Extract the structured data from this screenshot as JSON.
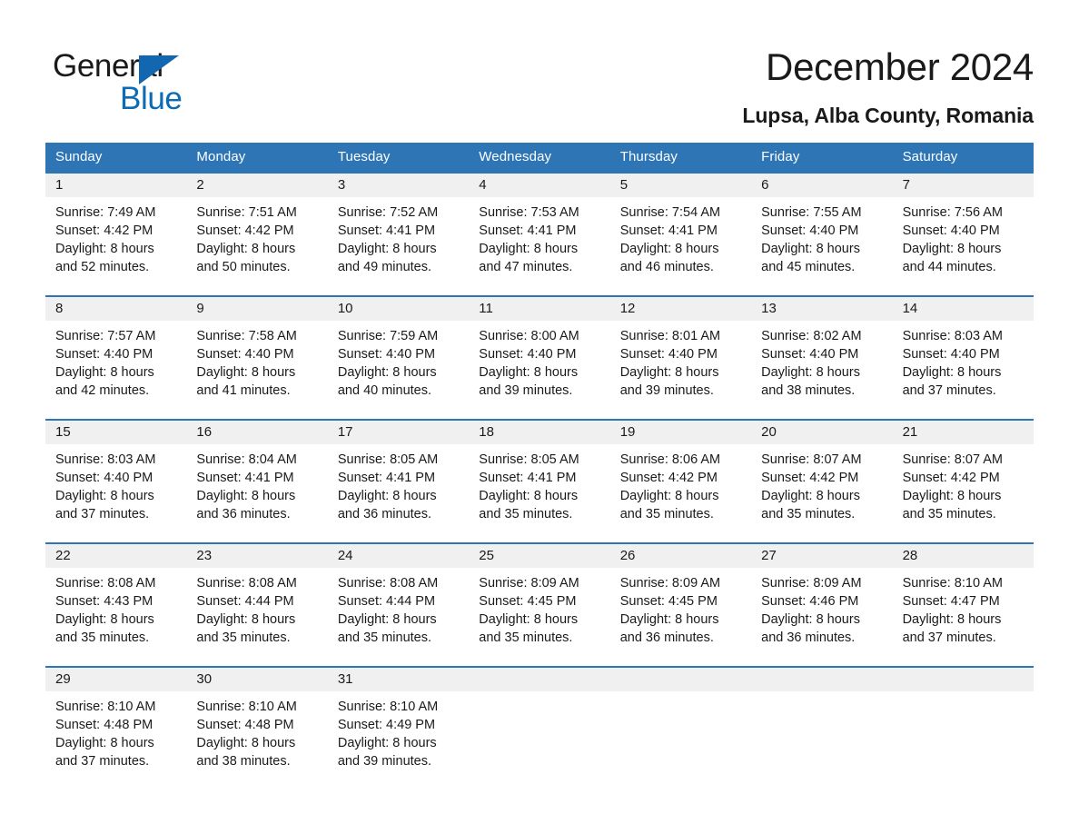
{
  "logo": {
    "word_one": "General",
    "word_two": "Blue",
    "triangle_color": "#1267b0",
    "blue_text_color": "#0b6cb5"
  },
  "header": {
    "title": "December 2024",
    "subtitle": "Lupsa, Alba County, Romania"
  },
  "theme": {
    "header_bar": "#2e75b6",
    "daynum_row": "#f0f0f0",
    "text": "#1a1a1a"
  },
  "weekdays": [
    "Sunday",
    "Monday",
    "Tuesday",
    "Wednesday",
    "Thursday",
    "Friday",
    "Saturday"
  ],
  "weeks": [
    [
      {
        "day": "1",
        "sunrise": "Sunrise: 7:49 AM",
        "sunset": "Sunset: 4:42 PM",
        "daylight_1": "Daylight: 8 hours",
        "daylight_2": "and 52 minutes."
      },
      {
        "day": "2",
        "sunrise": "Sunrise: 7:51 AM",
        "sunset": "Sunset: 4:42 PM",
        "daylight_1": "Daylight: 8 hours",
        "daylight_2": "and 50 minutes."
      },
      {
        "day": "3",
        "sunrise": "Sunrise: 7:52 AM",
        "sunset": "Sunset: 4:41 PM",
        "daylight_1": "Daylight: 8 hours",
        "daylight_2": "and 49 minutes."
      },
      {
        "day": "4",
        "sunrise": "Sunrise: 7:53 AM",
        "sunset": "Sunset: 4:41 PM",
        "daylight_1": "Daylight: 8 hours",
        "daylight_2": "and 47 minutes."
      },
      {
        "day": "5",
        "sunrise": "Sunrise: 7:54 AM",
        "sunset": "Sunset: 4:41 PM",
        "daylight_1": "Daylight: 8 hours",
        "daylight_2": "and 46 minutes."
      },
      {
        "day": "6",
        "sunrise": "Sunrise: 7:55 AM",
        "sunset": "Sunset: 4:40 PM",
        "daylight_1": "Daylight: 8 hours",
        "daylight_2": "and 45 minutes."
      },
      {
        "day": "7",
        "sunrise": "Sunrise: 7:56 AM",
        "sunset": "Sunset: 4:40 PM",
        "daylight_1": "Daylight: 8 hours",
        "daylight_2": "and 44 minutes."
      }
    ],
    [
      {
        "day": "8",
        "sunrise": "Sunrise: 7:57 AM",
        "sunset": "Sunset: 4:40 PM",
        "daylight_1": "Daylight: 8 hours",
        "daylight_2": "and 42 minutes."
      },
      {
        "day": "9",
        "sunrise": "Sunrise: 7:58 AM",
        "sunset": "Sunset: 4:40 PM",
        "daylight_1": "Daylight: 8 hours",
        "daylight_2": "and 41 minutes."
      },
      {
        "day": "10",
        "sunrise": "Sunrise: 7:59 AM",
        "sunset": "Sunset: 4:40 PM",
        "daylight_1": "Daylight: 8 hours",
        "daylight_2": "and 40 minutes."
      },
      {
        "day": "11",
        "sunrise": "Sunrise: 8:00 AM",
        "sunset": "Sunset: 4:40 PM",
        "daylight_1": "Daylight: 8 hours",
        "daylight_2": "and 39 minutes."
      },
      {
        "day": "12",
        "sunrise": "Sunrise: 8:01 AM",
        "sunset": "Sunset: 4:40 PM",
        "daylight_1": "Daylight: 8 hours",
        "daylight_2": "and 39 minutes."
      },
      {
        "day": "13",
        "sunrise": "Sunrise: 8:02 AM",
        "sunset": "Sunset: 4:40 PM",
        "daylight_1": "Daylight: 8 hours",
        "daylight_2": "and 38 minutes."
      },
      {
        "day": "14",
        "sunrise": "Sunrise: 8:03 AM",
        "sunset": "Sunset: 4:40 PM",
        "daylight_1": "Daylight: 8 hours",
        "daylight_2": "and 37 minutes."
      }
    ],
    [
      {
        "day": "15",
        "sunrise": "Sunrise: 8:03 AM",
        "sunset": "Sunset: 4:40 PM",
        "daylight_1": "Daylight: 8 hours",
        "daylight_2": "and 37 minutes."
      },
      {
        "day": "16",
        "sunrise": "Sunrise: 8:04 AM",
        "sunset": "Sunset: 4:41 PM",
        "daylight_1": "Daylight: 8 hours",
        "daylight_2": "and 36 minutes."
      },
      {
        "day": "17",
        "sunrise": "Sunrise: 8:05 AM",
        "sunset": "Sunset: 4:41 PM",
        "daylight_1": "Daylight: 8 hours",
        "daylight_2": "and 36 minutes."
      },
      {
        "day": "18",
        "sunrise": "Sunrise: 8:05 AM",
        "sunset": "Sunset: 4:41 PM",
        "daylight_1": "Daylight: 8 hours",
        "daylight_2": "and 35 minutes."
      },
      {
        "day": "19",
        "sunrise": "Sunrise: 8:06 AM",
        "sunset": "Sunset: 4:42 PM",
        "daylight_1": "Daylight: 8 hours",
        "daylight_2": "and 35 minutes."
      },
      {
        "day": "20",
        "sunrise": "Sunrise: 8:07 AM",
        "sunset": "Sunset: 4:42 PM",
        "daylight_1": "Daylight: 8 hours",
        "daylight_2": "and 35 minutes."
      },
      {
        "day": "21",
        "sunrise": "Sunrise: 8:07 AM",
        "sunset": "Sunset: 4:42 PM",
        "daylight_1": "Daylight: 8 hours",
        "daylight_2": "and 35 minutes."
      }
    ],
    [
      {
        "day": "22",
        "sunrise": "Sunrise: 8:08 AM",
        "sunset": "Sunset: 4:43 PM",
        "daylight_1": "Daylight: 8 hours",
        "daylight_2": "and 35 minutes."
      },
      {
        "day": "23",
        "sunrise": "Sunrise: 8:08 AM",
        "sunset": "Sunset: 4:44 PM",
        "daylight_1": "Daylight: 8 hours",
        "daylight_2": "and 35 minutes."
      },
      {
        "day": "24",
        "sunrise": "Sunrise: 8:08 AM",
        "sunset": "Sunset: 4:44 PM",
        "daylight_1": "Daylight: 8 hours",
        "daylight_2": "and 35 minutes."
      },
      {
        "day": "25",
        "sunrise": "Sunrise: 8:09 AM",
        "sunset": "Sunset: 4:45 PM",
        "daylight_1": "Daylight: 8 hours",
        "daylight_2": "and 35 minutes."
      },
      {
        "day": "26",
        "sunrise": "Sunrise: 8:09 AM",
        "sunset": "Sunset: 4:45 PM",
        "daylight_1": "Daylight: 8 hours",
        "daylight_2": "and 36 minutes."
      },
      {
        "day": "27",
        "sunrise": "Sunrise: 8:09 AM",
        "sunset": "Sunset: 4:46 PM",
        "daylight_1": "Daylight: 8 hours",
        "daylight_2": "and 36 minutes."
      },
      {
        "day": "28",
        "sunrise": "Sunrise: 8:10 AM",
        "sunset": "Sunset: 4:47 PM",
        "daylight_1": "Daylight: 8 hours",
        "daylight_2": "and 37 minutes."
      }
    ],
    [
      {
        "day": "29",
        "sunrise": "Sunrise: 8:10 AM",
        "sunset": "Sunset: 4:48 PM",
        "daylight_1": "Daylight: 8 hours",
        "daylight_2": "and 37 minutes."
      },
      {
        "day": "30",
        "sunrise": "Sunrise: 8:10 AM",
        "sunset": "Sunset: 4:48 PM",
        "daylight_1": "Daylight: 8 hours",
        "daylight_2": "and 38 minutes."
      },
      {
        "day": "31",
        "sunrise": "Sunrise: 8:10 AM",
        "sunset": "Sunset: 4:49 PM",
        "daylight_1": "Daylight: 8 hours",
        "daylight_2": "and 39 minutes."
      },
      {
        "day": "",
        "sunrise": "",
        "sunset": "",
        "daylight_1": "",
        "daylight_2": ""
      },
      {
        "day": "",
        "sunrise": "",
        "sunset": "",
        "daylight_1": "",
        "daylight_2": ""
      },
      {
        "day": "",
        "sunrise": "",
        "sunset": "",
        "daylight_1": "",
        "daylight_2": ""
      },
      {
        "day": "",
        "sunrise": "",
        "sunset": "",
        "daylight_1": "",
        "daylight_2": ""
      }
    ]
  ]
}
